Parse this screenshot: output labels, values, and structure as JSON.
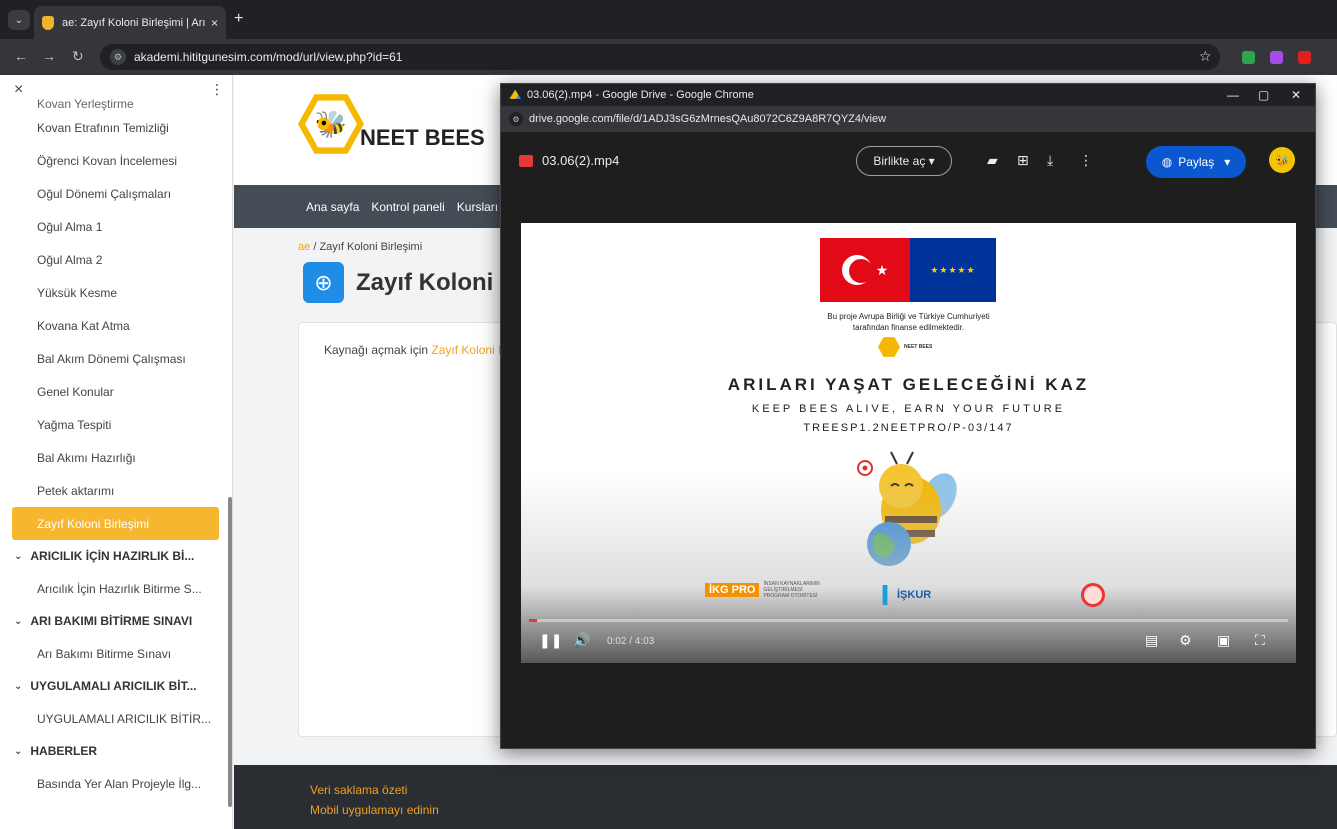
{
  "browser": {
    "tab_title": "ae: Zayıf Koloni Birleşimi | Arılar",
    "tab_close": "×",
    "new_tab": "+",
    "url": "akademi.hititgunesim.com/mod/url/view.php?id=61",
    "extension_colors": [
      "#2ea44f",
      "#a64ce8",
      "#e02020"
    ]
  },
  "drawer": {
    "close": "×",
    "kebab": "⋮",
    "items": [
      {
        "label": "Kovan Yerleştirme",
        "type": "item",
        "cut": true
      },
      {
        "label": "Kovan Etrafının Temizliği",
        "type": "item"
      },
      {
        "label": "Öğrenci Kovan İncelemesi",
        "type": "item"
      },
      {
        "label": "Oğul Dönemi Çalışmaları",
        "type": "item"
      },
      {
        "label": "Oğul Alma 1",
        "type": "item"
      },
      {
        "label": "Oğul Alma 2",
        "type": "item"
      },
      {
        "label": "Yüksük Kesme",
        "type": "item"
      },
      {
        "label": "Kovana Kat Atma",
        "type": "item"
      },
      {
        "label": "Bal Akım Dönemi Çalışması",
        "type": "item"
      },
      {
        "label": "Genel Konular",
        "type": "item"
      },
      {
        "label": "Yağma Tespiti",
        "type": "item"
      },
      {
        "label": "Bal Akımı Hazırlığı",
        "type": "item"
      },
      {
        "label": "Petek aktarımı",
        "type": "item"
      },
      {
        "label": "Zayıf Koloni Birleşimi",
        "type": "item",
        "active": true
      },
      {
        "label": "ARICILIK İÇİN HAZIRLIK Bİ...",
        "type": "section"
      },
      {
        "label": "Arıcılık İçin Hazırlık Bitirme S...",
        "type": "item"
      },
      {
        "label": "ARI BAKIMI BİTİRME SINAVI",
        "type": "section"
      },
      {
        "label": "Arı Bakımı Bitirme Sınavı",
        "type": "item"
      },
      {
        "label": "UYGULAMALI ARICILIK BİT...",
        "type": "section"
      },
      {
        "label": "UYGULAMALI ARICILIK BİTİR...",
        "type": "item"
      },
      {
        "label": "HABERLER",
        "type": "section"
      },
      {
        "label": "Basında Yer Alan Projeyle İlg...",
        "type": "item"
      }
    ]
  },
  "site": {
    "logo_text": "NEET BEES",
    "nav": [
      "Ana sayfa",
      "Kontrol paneli",
      "Kursları"
    ],
    "breadcrumb_root": "ae",
    "breadcrumb_sep": "/",
    "breadcrumb_current": "Zayıf Koloni Birleşimi",
    "title": "Zayıf Koloni",
    "content_prefix": "Kaynağı açmak için",
    "content_link": "Zayıf Koloni Bi",
    "footer_links": [
      "Veri saklama özeti",
      "Mobil uygulamayı edinin"
    ]
  },
  "popup": {
    "window_title": "03.06(2).mp4 - Google Drive - Google Chrome",
    "url": "drive.google.com/file/d/1ADJ3sG6zMrnesQAu8072C6Z9A8R7QYZ4/view",
    "file_name": "03.06(2).mp4",
    "open_with": "Birlikte aç ▾",
    "share": "Paylaş",
    "video": {
      "funded_line1": "Bu proje Avrupa Birliği ve Türkiye Cumhuriyeti",
      "funded_line2": "tarafından finanse edilmektedir.",
      "mini_logo": "NEET BEES",
      "heading": "ARILARI YAŞAT GELECEĞİNİ KAZ",
      "subheading": "KEEP BEES ALIVE, EARN YOUR FUTURE",
      "code": "TREESP1.2NEETPRO/P-03/147",
      "ikg_label": "İKG PRO",
      "ikg_small": "İNSAN KAYNAKLARININ GELİŞTİRİLMESİ PROGRAM OTORİTESİ",
      "iskur": "İŞKUR",
      "time": "0:02 / 4:03",
      "progress": 0.01
    }
  }
}
